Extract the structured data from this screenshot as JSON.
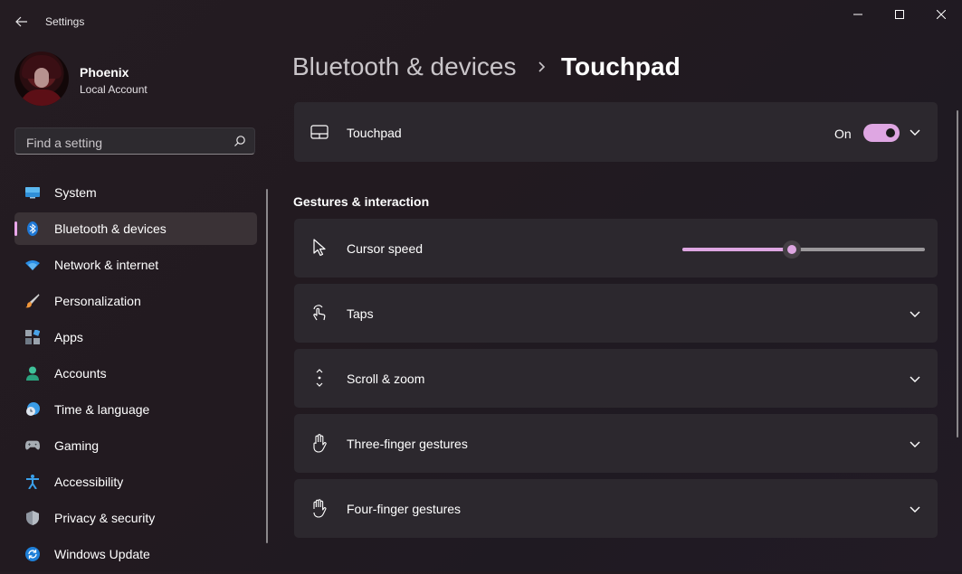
{
  "window": {
    "title": "Settings"
  },
  "profile": {
    "name": "Phoenix",
    "account_type": "Local Account"
  },
  "search": {
    "placeholder": "Find a setting"
  },
  "sidebar": {
    "items": [
      {
        "label": "System",
        "icon": "monitor-icon"
      },
      {
        "label": "Bluetooth & devices",
        "icon": "bluetooth-icon",
        "selected": true
      },
      {
        "label": "Network & internet",
        "icon": "wifi-icon"
      },
      {
        "label": "Personalization",
        "icon": "brush-icon"
      },
      {
        "label": "Apps",
        "icon": "apps-icon"
      },
      {
        "label": "Accounts",
        "icon": "person-icon"
      },
      {
        "label": "Time & language",
        "icon": "globe-clock-icon"
      },
      {
        "label": "Gaming",
        "icon": "gamepad-icon"
      },
      {
        "label": "Accessibility",
        "icon": "accessibility-icon"
      },
      {
        "label": "Privacy & security",
        "icon": "shield-icon"
      },
      {
        "label": "Windows Update",
        "icon": "sync-icon"
      }
    ]
  },
  "header": {
    "parent": "Bluetooth & devices",
    "current": "Touchpad"
  },
  "touchpad": {
    "label": "Touchpad",
    "state_label": "On",
    "enabled": true
  },
  "section": {
    "title": "Gestures & interaction"
  },
  "cursor_speed": {
    "label": "Cursor speed",
    "value_fraction": 0.45
  },
  "rows": [
    {
      "label": "Taps",
      "icon": "tap-icon"
    },
    {
      "label": "Scroll & zoom",
      "icon": "scroll-icon"
    },
    {
      "label": "Three-finger gestures",
      "icon": "hand-icon"
    },
    {
      "label": "Four-finger gestures",
      "icon": "hand-icon"
    }
  ],
  "colors": {
    "accent": "#dea6e2",
    "card": "#2c282e",
    "background": "#231b21"
  }
}
